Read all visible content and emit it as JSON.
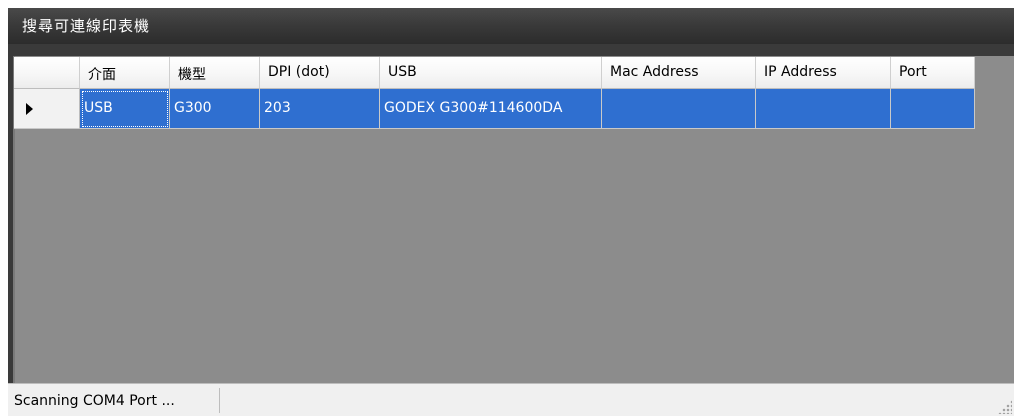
{
  "window": {
    "title": "搜尋可連線印表機"
  },
  "grid": {
    "columns": [
      "介面",
      "機型",
      "DPI (dot)",
      "USB",
      "Mac Address",
      "IP Address",
      "Port"
    ],
    "rows": [
      {
        "selected": true,
        "cells": [
          "USB",
          "G300",
          "203",
          "GODEX G300#114600DA",
          "",
          "",
          ""
        ]
      }
    ]
  },
  "status": {
    "text": "Scanning COM4 Port ..."
  },
  "colors": {
    "selection": "#2f6fd0",
    "empty_area": "#8c8c8c",
    "title_bar": "#3a3a3a"
  }
}
